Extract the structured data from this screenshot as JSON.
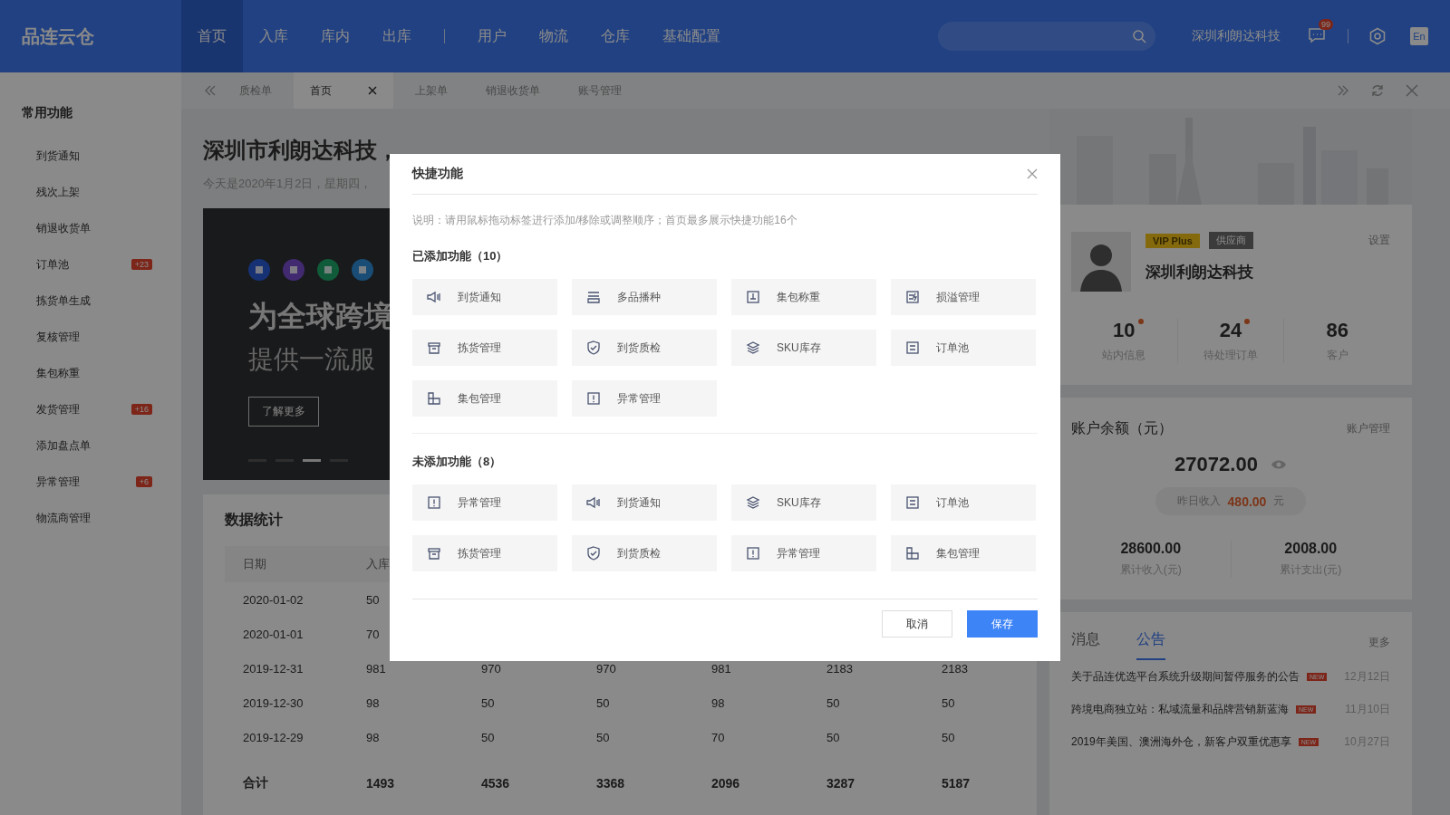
{
  "header": {
    "logo": "品连云仓",
    "nav_groups": [
      [
        {
          "label": "首页",
          "selected": true
        },
        {
          "label": "入库",
          "selected": false
        },
        {
          "label": "库内",
          "selected": false
        },
        {
          "label": "出库",
          "selected": false
        }
      ],
      [
        {
          "label": "用户",
          "selected": false
        },
        {
          "label": "物流",
          "selected": false
        },
        {
          "label": "仓库",
          "selected": false
        },
        {
          "label": "基础配置",
          "selected": false
        }
      ]
    ],
    "company": "深圳利朗达科技",
    "message_badge": "99",
    "language": "En"
  },
  "page_tabs": [
    {
      "label": "质检单",
      "selected": false,
      "closable": false
    },
    {
      "label": "首页",
      "selected": true,
      "closable": true
    },
    {
      "label": "上架单",
      "selected": false,
      "closable": false
    },
    {
      "label": "销退收货单",
      "selected": false,
      "closable": false
    },
    {
      "label": "账号管理",
      "selected": false,
      "closable": false
    }
  ],
  "sidebar": {
    "title": "常用功能",
    "items": [
      {
        "label": "到货通知"
      },
      {
        "label": "残次上架"
      },
      {
        "label": "销退收货单"
      },
      {
        "label": "订单池",
        "badge": "+23"
      },
      {
        "label": "拣货单生成"
      },
      {
        "label": "复核管理"
      },
      {
        "label": "集包称重"
      },
      {
        "label": "发货管理",
        "badge": "+16"
      },
      {
        "label": "添加盘点单"
      },
      {
        "label": "异常管理",
        "badge": "+6"
      },
      {
        "label": "物流商管理"
      }
    ]
  },
  "greeting": {
    "title": "深圳市利朗达科技，",
    "subtitle": "今天是2020年1月2日，星期四，"
  },
  "banner": {
    "headline": "为全球跨境",
    "subline": "提供一流服",
    "button": "了解更多",
    "dots": [
      {
        "selected": false
      },
      {
        "selected": false
      },
      {
        "selected": true
      },
      {
        "selected": false
      }
    ]
  },
  "stats": {
    "title": "数据统计",
    "columns": [
      "日期",
      "入库"
    ],
    "rows": [
      [
        "2020-01-02",
        "50"
      ],
      [
        "2020-01-01",
        "70"
      ],
      [
        "2019-12-31",
        "981",
        "970",
        "970",
        "981",
        "2183",
        "2183"
      ],
      [
        "2019-12-30",
        "98",
        "50",
        "50",
        "98",
        "50",
        "50"
      ],
      [
        "2019-12-29",
        "98",
        "50",
        "50",
        "70",
        "50",
        "50"
      ]
    ],
    "total": [
      "合计",
      "1493",
      "4536",
      "3368",
      "2096",
      "3287",
      "5187"
    ]
  },
  "profile": {
    "badges": [
      {
        "label": "VIP Plus",
        "kind": "vip"
      },
      {
        "label": "供应商",
        "kind": "role"
      }
    ],
    "settings": "设置",
    "name": "深圳利朗达科技",
    "stats": [
      {
        "value": "10",
        "label": "站内信息",
        "alert": true
      },
      {
        "value": "24",
        "label": "待处理订单",
        "alert": true
      },
      {
        "value": "86",
        "label": "客户",
        "alert": false
      }
    ]
  },
  "account": {
    "title": "账户余额（元）",
    "link": "账户管理",
    "balance": "27072.00",
    "yesterday_label": "昨日收入",
    "yesterday_value": "480.00",
    "yesterday_unit": "元",
    "totals": [
      {
        "value": "28600.00",
        "label": "累计收入(元)"
      },
      {
        "value": "2008.00",
        "label": "累计支出(元)"
      }
    ]
  },
  "notices": {
    "tabs": [
      {
        "label": "消息",
        "selected": false
      },
      {
        "label": "公告",
        "selected": true
      }
    ],
    "more": "更多",
    "items": [
      {
        "title": "关于品连优选平台系统升级期间暂停服务的公告",
        "badge": "NEW",
        "date": "12月12日"
      },
      {
        "title": "跨境电商独立站：私域流量和品牌营销新蓝海",
        "badge": "NEW",
        "date": "11月10日"
      },
      {
        "title": "2019年美国、澳洲海外仓，新客户双重优惠享",
        "badge": "NEW",
        "date": "10月27日"
      }
    ]
  },
  "modal": {
    "title": "快捷功能",
    "note": "说明：请用鼠标拖动标签进行添加/移除或调整顺序；首页最多展示快捷功能16个",
    "sections": [
      {
        "title": "已添加功能（10）",
        "items": [
          {
            "label": "到货通知",
            "kind": "speaker"
          },
          {
            "label": "多品播种",
            "kind": "rows"
          },
          {
            "label": "集包称重",
            "kind": "scale"
          },
          {
            "label": "损溢管理",
            "kind": "swap"
          },
          {
            "label": "拣货管理",
            "kind": "box"
          },
          {
            "label": "到货质检",
            "kind": "shield"
          },
          {
            "label": "SKU库存",
            "kind": "layers"
          },
          {
            "label": "订单池",
            "kind": "list"
          },
          {
            "label": "集包管理",
            "kind": "blocks"
          },
          {
            "label": "异常管理",
            "kind": "alert"
          }
        ]
      },
      {
        "title": "未添加功能（8）",
        "items": [
          {
            "label": "异常管理",
            "kind": "alert"
          },
          {
            "label": "到货通知",
            "kind": "speaker"
          },
          {
            "label": "SKU库存",
            "kind": "layers"
          },
          {
            "label": "订单池",
            "kind": "list"
          },
          {
            "label": "拣货管理",
            "kind": "box"
          },
          {
            "label": "到货质检",
            "kind": "shield"
          },
          {
            "label": "异常管理",
            "kind": "alert"
          },
          {
            "label": "集包管理",
            "kind": "blocks"
          }
        ]
      }
    ],
    "buttons": [
      {
        "label": "取消",
        "kind": "secondary"
      },
      {
        "label": "保存",
        "kind": "primary"
      }
    ]
  }
}
